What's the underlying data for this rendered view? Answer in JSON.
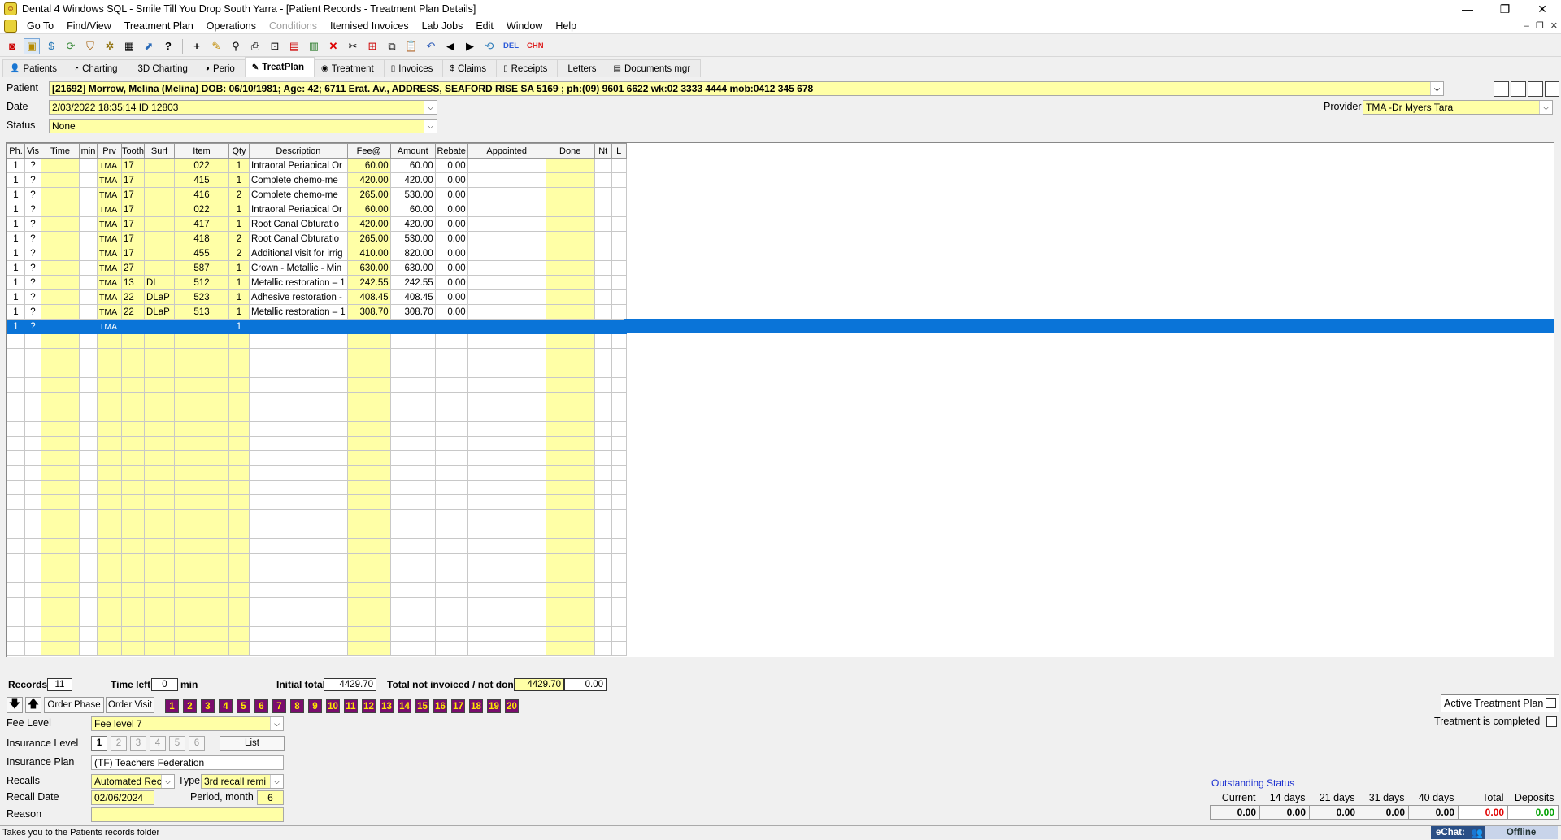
{
  "window": {
    "title": "Dental 4 Windows SQL - Smile Till You Drop South Yarra - [Patient Records - Treatment Plan Details]",
    "min_glyph": "—",
    "max_glyph": "❐",
    "close_glyph": "✕"
  },
  "menu": [
    "Go To",
    "Find/View",
    "Treatment Plan",
    "Operations",
    "Conditions",
    "Itemised Invoices",
    "Lab Jobs",
    "Edit",
    "Window",
    "Help"
  ],
  "menu_disabled": [
    "Conditions"
  ],
  "toolbar": {
    "del_label": "DEL",
    "chn_label": "CHN"
  },
  "tabs": [
    {
      "label": "Patients",
      "icon": "person-icon"
    },
    {
      "label": "Charting",
      "icon": "tooth-chart-icon"
    },
    {
      "label": "3D Charting",
      "icon": "3d-tooth-icon"
    },
    {
      "label": "Perio",
      "icon": "perio-icon"
    },
    {
      "label": "TreatPlan",
      "icon": "treatplan-icon",
      "active": true
    },
    {
      "label": "Treatment",
      "icon": "treatment-icon"
    },
    {
      "label": "Invoices",
      "icon": "invoice-icon"
    },
    {
      "label": "Claims",
      "icon": "claims-icon"
    },
    {
      "label": "Receipts",
      "icon": "receipt-icon"
    },
    {
      "label": "Letters",
      "icon": "letter-icon"
    },
    {
      "label": "Documents mgr",
      "icon": "documents-icon"
    }
  ],
  "patient": {
    "label": "Patient",
    "value": "[21692] Morrow, Melina (Melina) DOB: 06/10/1981; Age: 42; 6711 Erat. Av., ADDRESS, SEAFORD RISE SA 5169 ; ph:(09) 9601 6622 wk:02 3333 4444 mob:0412 345 678"
  },
  "date": {
    "label": "Date",
    "value": "2/03/2022 18:35:14  ID 12803"
  },
  "status": {
    "label": "Status",
    "value": "None"
  },
  "provider": {
    "label": "Provider",
    "value": "TMA -Dr Myers Tara"
  },
  "grid": {
    "columns": [
      "Ph.",
      "Vis",
      "Time",
      "min",
      "Prv",
      "Tooth",
      "Surf",
      "Item",
      "Qty",
      "Description",
      "Fee@",
      "Amount",
      "Rebate",
      "Appointed",
      "Done",
      "Nt",
      "L"
    ],
    "rows": [
      [
        "1",
        "?",
        "",
        "",
        "TMA",
        "17",
        "",
        "022",
        "1",
        "Intraoral Periapical Or",
        "60.00",
        "60.00",
        "0.00",
        "",
        "",
        "",
        ""
      ],
      [
        "1",
        "?",
        "",
        "",
        "TMA",
        "17",
        "",
        "415",
        "1",
        "Complete chemo-me",
        "420.00",
        "420.00",
        "0.00",
        "",
        "",
        "",
        ""
      ],
      [
        "1",
        "?",
        "",
        "",
        "TMA",
        "17",
        "",
        "416",
        "2",
        "Complete chemo-me",
        "265.00",
        "530.00",
        "0.00",
        "",
        "",
        "",
        ""
      ],
      [
        "1",
        "?",
        "",
        "",
        "TMA",
        "17",
        "",
        "022",
        "1",
        "Intraoral Periapical Or",
        "60.00",
        "60.00",
        "0.00",
        "",
        "",
        "",
        ""
      ],
      [
        "1",
        "?",
        "",
        "",
        "TMA",
        "17",
        "",
        "417",
        "1",
        "Root Canal Obturatio",
        "420.00",
        "420.00",
        "0.00",
        "",
        "",
        "",
        ""
      ],
      [
        "1",
        "?",
        "",
        "",
        "TMA",
        "17",
        "",
        "418",
        "2",
        "Root Canal Obturatio",
        "265.00",
        "530.00",
        "0.00",
        "",
        "",
        "",
        ""
      ],
      [
        "1",
        "?",
        "",
        "",
        "TMA",
        "17",
        "",
        "455",
        "2",
        "Additional visit for irrig",
        "410.00",
        "820.00",
        "0.00",
        "",
        "",
        "",
        ""
      ],
      [
        "1",
        "?",
        "",
        "",
        "TMA",
        "27",
        "",
        "587",
        "1",
        "Crown - Metallic - Min",
        "630.00",
        "630.00",
        "0.00",
        "",
        "",
        "",
        ""
      ],
      [
        "1",
        "?",
        "",
        "",
        "TMA",
        "13",
        "DI",
        "512",
        "1",
        "Metallic restoration – 1",
        "242.55",
        "242.55",
        "0.00",
        "",
        "",
        "",
        ""
      ],
      [
        "1",
        "?",
        "",
        "",
        "TMA",
        "22",
        "DLaP",
        "523",
        "1",
        "Adhesive restoration -",
        "408.45",
        "408.45",
        "0.00",
        "",
        "",
        "",
        ""
      ],
      [
        "1",
        "?",
        "",
        "",
        "TMA",
        "22",
        "DLaP",
        "513",
        "1",
        "Metallic restoration – 1",
        "308.70",
        "308.70",
        "0.00",
        "",
        "",
        "",
        ""
      ],
      [
        "1",
        "?",
        "",
        "",
        "TMA",
        "",
        "",
        "",
        "1",
        "",
        "",
        "",
        "",
        "",
        "",
        "",
        ""
      ]
    ],
    "selected_row": 11,
    "empty_rows": 22
  },
  "totals": {
    "records_label": "Records",
    "records": "11",
    "timeleft_label": "Time left",
    "timeleft": "0",
    "min_label": "min",
    "initial_label": "Initial total",
    "initial": "4429.70",
    "notinv_label": "Total not invoiced / not done",
    "notinv": "4429.70",
    "notdone": "0.00"
  },
  "order": {
    "phase": "Order Phase",
    "visit": "Order Visit"
  },
  "visits": [
    "1",
    "2",
    "3",
    "4",
    "5",
    "6",
    "7",
    "8",
    "9",
    "10",
    "11",
    "12",
    "13",
    "14",
    "15",
    "16",
    "17",
    "18",
    "19",
    "20"
  ],
  "active_plan": {
    "label": "Active Treatment Plan",
    "checked": false
  },
  "completed": {
    "label": "Treatment is completed",
    "checked": false
  },
  "fee_level": {
    "label": "Fee Level",
    "value": "Fee level 7"
  },
  "insurance_level": {
    "label": "Insurance Level",
    "levels": [
      "1",
      "2",
      "3",
      "4",
      "5",
      "6"
    ],
    "selected": "1",
    "list_label": "List"
  },
  "insurance_plan": {
    "label": "Insurance Plan",
    "value": "(TF) Teachers Federation"
  },
  "recalls": {
    "label": "Recalls",
    "value": "Automated Rec",
    "type_label": "Type",
    "type_value": "3rd recall remi"
  },
  "recall_date": {
    "label": "Recall Date",
    "value": "02/06/2024",
    "period_label": "Period, month",
    "period": "6"
  },
  "reason": {
    "label": "Reason",
    "value": ""
  },
  "outstanding": {
    "title": "Outstanding Status",
    "headers": [
      "Current",
      "14 days",
      "21 days",
      "31 days",
      "40 days",
      "Total",
      "Deposits"
    ],
    "values": [
      "0.00",
      "0.00",
      "0.00",
      "0.00",
      "0.00",
      "0.00",
      "0.00"
    ],
    "total_color": "#e00000",
    "deposits_color": "#00a000",
    "title_color": "#1a2fd0"
  },
  "statusbar": {
    "text": "Takes you to the Patients records folder"
  },
  "echat": {
    "label": "eChat:",
    "status": "Offline"
  }
}
